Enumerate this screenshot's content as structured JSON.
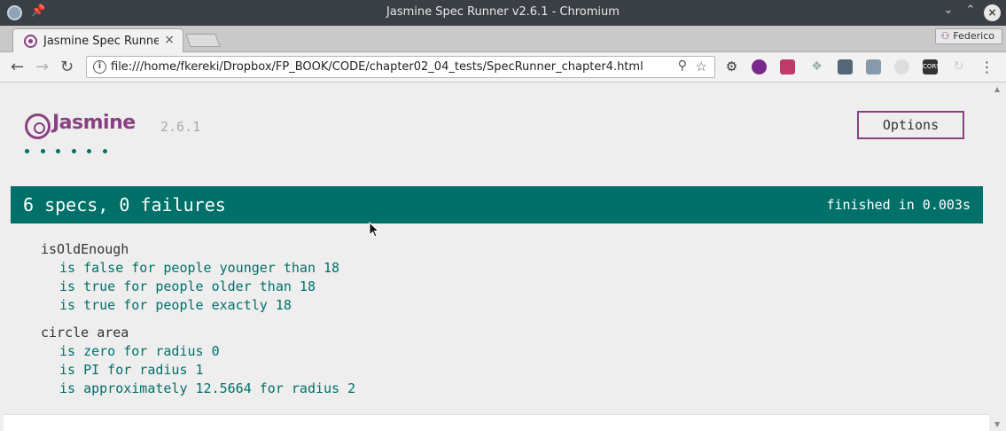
{
  "window": {
    "title": "Jasmine Spec Runner v2.6.1 - Chromium"
  },
  "tabs": [
    {
      "title": "Jasmine Spec Runner",
      "close": "×"
    }
  ],
  "profile": {
    "name": "Federico"
  },
  "address_bar": {
    "url": "file:///home/fkereki/Dropbox/FP_BOOK/CODE/chapter02_04_tests/SpecRunner_chapter4.html"
  },
  "extensions": [
    "gear-icon",
    "opera-icon",
    "gmail-icon",
    "dropbox-icon",
    "screenshot-icon",
    "qr-icon",
    "loading-icon",
    "cors-icon",
    "refresh-icon"
  ],
  "extension_labels": {
    "cors": "CORS"
  },
  "jasmine": {
    "logo_text": "Jasmine",
    "version": "2.6.1",
    "options_label": "Options",
    "dots_count": 6,
    "overall_result": "6 specs, 0 failures",
    "duration": "finished in 0.003s",
    "suites": [
      {
        "description": "isOldEnough",
        "specs": [
          "is false for people younger than 18",
          "is true for people older than 18",
          "is true for people exactly 18"
        ]
      },
      {
        "description": "circle area",
        "specs": [
          "is zero for radius 0",
          "is PI for radius 1",
          "is approximately 12.5664 for radius 2"
        ]
      }
    ]
  },
  "colors": {
    "jasmine_purple": "#8a4182",
    "jasmine_green": "#007069"
  }
}
